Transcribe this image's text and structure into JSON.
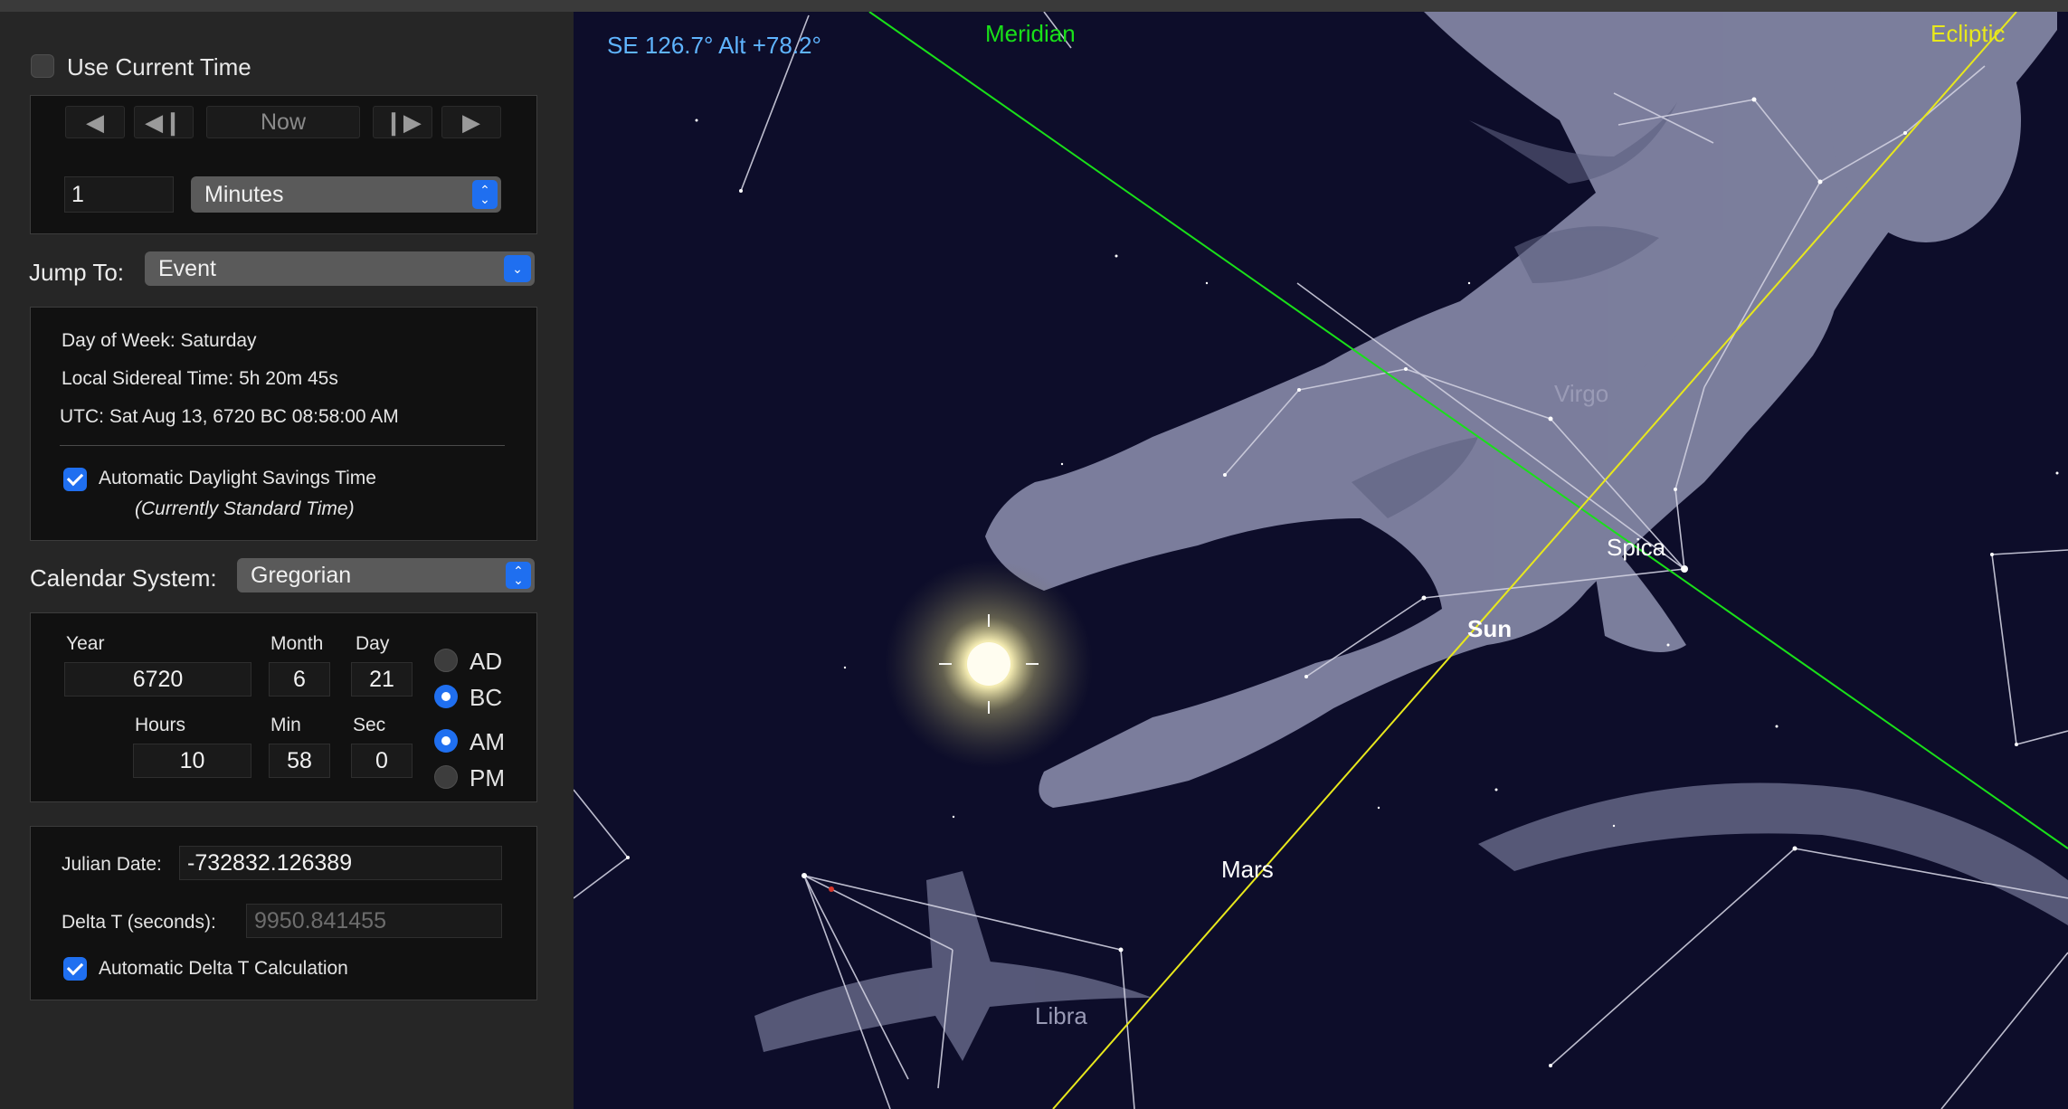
{
  "time_controls": {
    "use_current_time_label": "Use Current Time",
    "use_current_time_checked": false,
    "now_label": "Now",
    "step_value": "1",
    "step_unit": "Minutes"
  },
  "jump_to": {
    "label": "Jump To:",
    "value": "Event"
  },
  "info": {
    "day_of_week": "Day of Week:  Saturday",
    "sidereal": "Local Sidereal Time:  5h 20m 45s",
    "utc": "UTC:  Sat Aug 13, 6720 BC 08:58:00 AM",
    "dst_label": "Automatic Daylight Savings Time",
    "dst_checked": true,
    "dst_note": "(Currently Standard Time)"
  },
  "calendar": {
    "label": "Calendar System:",
    "value": "Gregorian"
  },
  "date": {
    "year_label": "Year",
    "month_label": "Month",
    "day_label": "Day",
    "year": "6720",
    "month": "6",
    "day": "21",
    "hours_label": "Hours",
    "min_label": "Min",
    "sec_label": "Sec",
    "hours": "10",
    "min": "58",
    "sec": "0",
    "ad_label": "AD",
    "bc_label": "BC",
    "am_label": "AM",
    "pm_label": "PM",
    "era_selected": "BC",
    "period_selected": "AM"
  },
  "julian": {
    "label": "Julian Date:",
    "value": "-732832.126389",
    "delta_label": "Delta T (seconds):",
    "delta_placeholder": "9950.841455",
    "auto_delta_label": "Automatic Delta T Calculation",
    "auto_delta_checked": true
  },
  "sky": {
    "position_readout": "SE 126.7° Alt +78.2°",
    "meridian_label": "Meridian",
    "ecliptic_label": "Ecliptic",
    "virgo_label": "Virgo",
    "spica_label": "Spica",
    "sun_label": "Sun",
    "mars_label": "Mars",
    "libra_label": "Libra",
    "colors": {
      "background": "#0d0d2a",
      "meridian": "#19e019",
      "ecliptic": "#e8e81c",
      "readout": "#5fb4ff",
      "constellation_lines": "#d0d0e0",
      "mars": "#d8362a"
    }
  }
}
